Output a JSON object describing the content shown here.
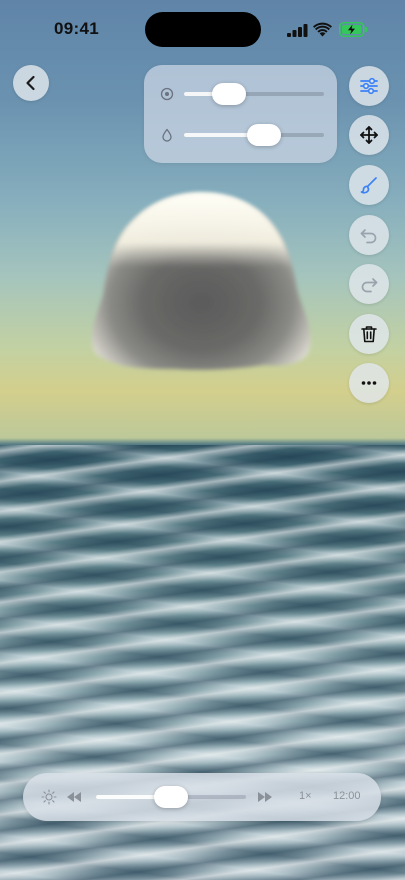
{
  "status_bar": {
    "time": "09:41"
  },
  "controls": {
    "slider_panel": {
      "size_slider": {
        "icon": "target-icon",
        "value": 0.32
      },
      "opacity_slider": {
        "icon": "drop-icon",
        "value": 0.57
      }
    },
    "toolbar": [
      {
        "name": "adjustments-button",
        "icon": "sliders-icon",
        "active": true
      },
      {
        "name": "move-button",
        "icon": "move-arrows-icon",
        "active": false
      },
      {
        "name": "brush-button",
        "icon": "brush-icon",
        "active": false
      },
      {
        "name": "undo-button",
        "icon": "undo-icon",
        "active": false
      },
      {
        "name": "redo-button",
        "icon": "redo-icon",
        "active": false
      },
      {
        "name": "delete-button",
        "icon": "trash-icon",
        "active": false
      },
      {
        "name": "more-button",
        "icon": "ellipsis-icon",
        "active": false
      }
    ]
  },
  "playback": {
    "speed_label": "1×",
    "time_label": "12:00",
    "progress": 0.5
  },
  "colors": {
    "accent": "#3b82f6",
    "disabled_icon": "#9aa3ad"
  }
}
